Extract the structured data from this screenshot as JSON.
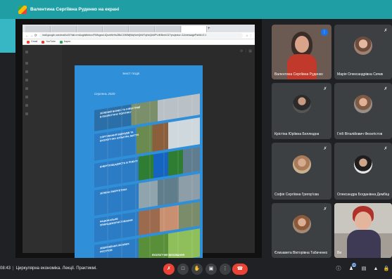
{
  "presenting": {
    "title": "Валентина Сергіївна Руденко на екрані"
  },
  "browser": {
    "url": "mail.google.com/mail/u/0/?tab=rm&ogbl#inbox/FMfcgxwLtQxzbNrHsZBkCZWlNfjWqNvbQhMTqNxQkMPVdKBmhGZ?projector=1&messagePartId=0.1",
    "bookmarks": [
      "Gmail",
      "YouTube",
      "Карти"
    ]
  },
  "brochure": {
    "header": "ЗМІСТ ПОДІЇ",
    "date": "Серпень 2020",
    "captions": [
      "Зелений бізнес та інвестиції в екологічну політику",
      "Сортування відходів та екологічна культура життя",
      "Енергоощадність в побуті",
      "Зелена енергетика",
      "Раціональне природокористування",
      "Збереження лісових ресурсів"
    ],
    "footer_caption": "ЕКОЛОГІЧНЕ ВИХОВАННЯ"
  },
  "participants": [
    {
      "name": "Валентина Сергіївна Руденко",
      "speaking": true
    },
    {
      "name": "Марія Олександрівна Сичик",
      "muted": true
    },
    {
      "name": "Крістіна Юріївна Беллюдна",
      "muted": true
    },
    {
      "name": "Гліб Віталійович Феоктістов",
      "muted": true
    },
    {
      "name": "Софія Сергіївна Григор'єва",
      "muted": true
    },
    {
      "name": "Олександра Богданівна Дембіцька",
      "muted": true
    },
    {
      "name": "Єлизавета Вікторівна Табаченко",
      "muted": true
    },
    {
      "name": "Ви",
      "muted": false
    }
  ],
  "meeting": {
    "time": "08:43",
    "title": "Циркулярна економіка. Лекції. Практикмі.",
    "people_count": "10"
  },
  "colors": {
    "accent": "#1f9fa3",
    "danger": "#ea4335",
    "tile": "#3c4043",
    "background": "#202124"
  },
  "icons": {
    "mic_off": "mic-off-icon",
    "camera_off": "camera-off-icon",
    "hand": "raise-hand-icon",
    "present": "present-icon",
    "more": "more-vert-icon",
    "end": "call-end-icon",
    "info": "info-icon",
    "people": "people-icon",
    "chat": "chat-icon",
    "activities": "activities-icon",
    "lock": "lock-icon"
  }
}
